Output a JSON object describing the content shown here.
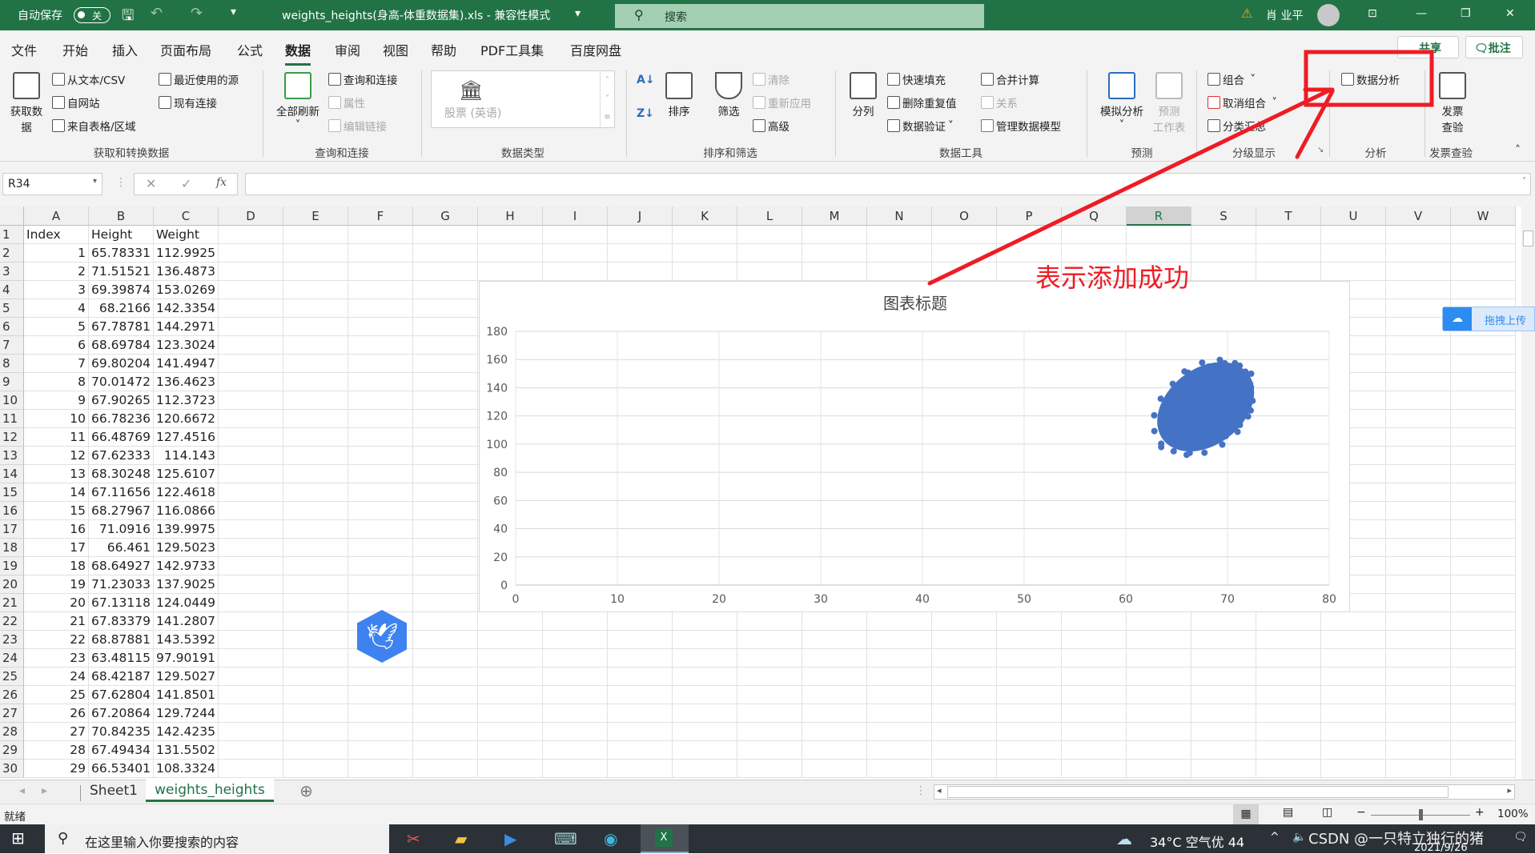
{
  "titlebar": {
    "autosave_label": "自动保存",
    "autosave_state": "关",
    "title": "weights_heights(身高-体重数据集).xls  -  兼容性模式",
    "search_placeholder": "搜索",
    "user_name": "肖 业平"
  },
  "menu": {
    "tabs": [
      "文件",
      "开始",
      "插入",
      "页面布局",
      "公式",
      "数据",
      "审阅",
      "视图",
      "帮助",
      "PDF工具集",
      "百度网盘"
    ],
    "active": "数据",
    "share": "共享",
    "comment": "批注"
  },
  "ribbon": {
    "get_data": {
      "big": "获取数据",
      "items": [
        "从文本/CSV",
        "自网站",
        "来自表格/区域",
        "最近使用的源",
        "现有连接"
      ],
      "label": "获取和转换数据"
    },
    "query": {
      "big": "全部刷新",
      "items": [
        "查询和连接",
        "属性",
        "编辑链接"
      ],
      "label": "查询和连接"
    },
    "datatype": {
      "item": "股票 (英语)",
      "label": "数据类型"
    },
    "sort": {
      "sort": "排序",
      "filter": "筛选",
      "items": [
        "清除",
        "重新应用",
        "高级"
      ],
      "label": "排序和筛选"
    },
    "tools": {
      "big": "分列",
      "items": [
        "快速填充",
        "删除重复值",
        "数据验证",
        "合并计算",
        "关系",
        "管理数据模型"
      ],
      "label": "数据工具"
    },
    "forecast": {
      "whatif": "模拟分析",
      "sheet": "预测\n工作表",
      "label": "预测"
    },
    "outline": {
      "items": [
        "组合",
        "取消组合",
        "分类汇总"
      ],
      "label": "分级显示"
    },
    "analysis": {
      "item": "数据分析",
      "label": "分析"
    },
    "invoice": {
      "big": "发票\n查验",
      "label": "发票查验"
    }
  },
  "formula_bar": {
    "name_box": "R34",
    "fx": "fx",
    "value": ""
  },
  "columns": [
    "A",
    "B",
    "C",
    "D",
    "E",
    "F",
    "G",
    "H",
    "I",
    "J",
    "K",
    "L",
    "M",
    "N",
    "O",
    "P",
    "Q",
    "R",
    "S",
    "T",
    "U",
    "V",
    "W"
  ],
  "selected_column": "R",
  "row_numbers": [
    "1",
    "2",
    "3",
    "4",
    "5",
    "6",
    "7",
    "8",
    "9",
    "10",
    "11",
    "12",
    "13",
    "14",
    "15",
    "16",
    "17",
    "18",
    "19",
    "20",
    "21",
    "22",
    "23",
    "24",
    "25",
    "26",
    "27",
    "28",
    "29",
    "30"
  ],
  "table": {
    "headers": [
      "Index",
      "Height",
      "Weight"
    ],
    "rows": [
      [
        "1",
        "65.78331",
        "112.9925"
      ],
      [
        "2",
        "71.51521",
        "136.4873"
      ],
      [
        "3",
        "69.39874",
        "153.0269"
      ],
      [
        "4",
        "68.2166",
        "142.3354"
      ],
      [
        "5",
        "67.78781",
        "144.2971"
      ],
      [
        "6",
        "68.69784",
        "123.3024"
      ],
      [
        "7",
        "69.80204",
        "141.4947"
      ],
      [
        "8",
        "70.01472",
        "136.4623"
      ],
      [
        "9",
        "67.90265",
        "112.3723"
      ],
      [
        "10",
        "66.78236",
        "120.6672"
      ],
      [
        "11",
        "66.48769",
        "127.4516"
      ],
      [
        "12",
        "67.62333",
        "114.143"
      ],
      [
        "13",
        "68.30248",
        "125.6107"
      ],
      [
        "14",
        "67.11656",
        "122.4618"
      ],
      [
        "15",
        "68.27967",
        "116.0866"
      ],
      [
        "16",
        "71.0916",
        "139.9975"
      ],
      [
        "17",
        "66.461",
        "129.5023"
      ],
      [
        "18",
        "68.64927",
        "142.9733"
      ],
      [
        "19",
        "71.23033",
        "137.9025"
      ],
      [
        "20",
        "67.13118",
        "124.0449"
      ],
      [
        "21",
        "67.83379",
        "141.2807"
      ],
      [
        "22",
        "68.87881",
        "143.5392"
      ],
      [
        "23",
        "63.48115",
        "97.90191"
      ],
      [
        "24",
        "68.42187",
        "129.5027"
      ],
      [
        "25",
        "67.62804",
        "141.8501"
      ],
      [
        "26",
        "67.20864",
        "129.7244"
      ],
      [
        "27",
        "70.84235",
        "142.4235"
      ],
      [
        "28",
        "67.49434",
        "131.5502"
      ],
      [
        "29",
        "66.53401",
        "108.3324"
      ]
    ]
  },
  "chart_data": {
    "type": "scatter",
    "title": "图表标题",
    "xlim": [
      0,
      80
    ],
    "ylim": [
      0,
      180
    ],
    "xticks": [
      "0",
      "10",
      "20",
      "30",
      "40",
      "50",
      "60",
      "70",
      "80"
    ],
    "yticks": [
      "0",
      "20",
      "40",
      "60",
      "80",
      "100",
      "120",
      "140",
      "160",
      "180"
    ],
    "grid": true,
    "color": "#4472c4",
    "x_source": "Height",
    "y_source": "Weight",
    "point_cloud": {
      "x_range": [
        60.5,
        75.2
      ],
      "y_range": [
        83,
        170
      ]
    }
  },
  "annotation": {
    "text": "表示添加成功",
    "color": "#ee1c25"
  },
  "floating": {
    "baidu_upload": "拖拽上传"
  },
  "sheets": {
    "tabs": [
      "Sheet1",
      "weights_heights"
    ],
    "active": "weights_heights"
  },
  "status": {
    "ready": "就绪",
    "zoom": "100%",
    "zoom_level": 100
  },
  "taskbar": {
    "search_placeholder": "在这里输入你要搜索的内容",
    "weather": "34°C  空气优 44",
    "watermark": "CSDN @一只特立独行的猪",
    "date": "2021/9/26"
  }
}
